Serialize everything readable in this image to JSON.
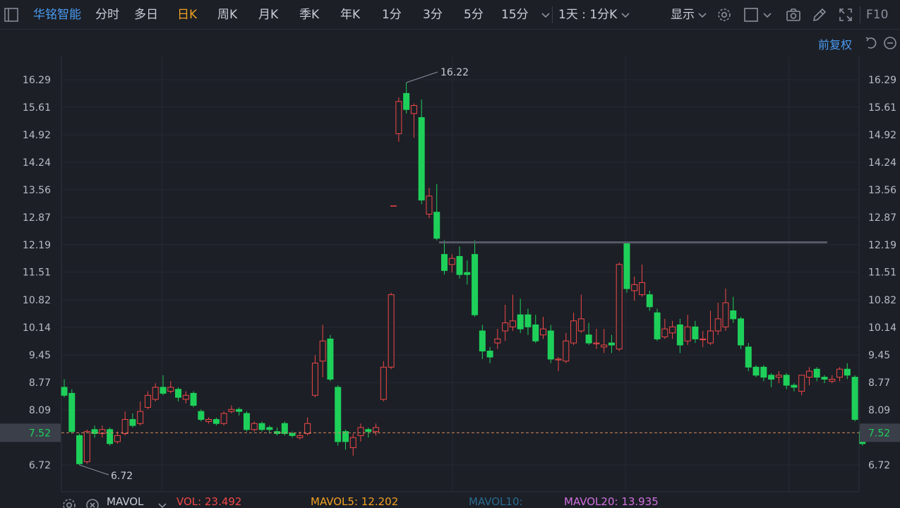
{
  "toolbar": {
    "stock_name": "华铭智能",
    "periods": [
      {
        "label": "分时",
        "active": false
      },
      {
        "label": "多日",
        "active": false
      },
      {
        "label": "日K",
        "active": true
      },
      {
        "label": "周K",
        "active": false
      },
      {
        "label": "月K",
        "active": false
      },
      {
        "label": "季K",
        "active": false
      },
      {
        "label": "年K",
        "active": false
      },
      {
        "label": "1分",
        "active": false
      },
      {
        "label": "3分",
        "active": false
      },
      {
        "label": "5分",
        "active": false
      },
      {
        "label": "15分",
        "active": false
      }
    ],
    "multi_period": "1天 : 1分K",
    "display_label": "显示",
    "f10_label": "F10"
  },
  "adjust_label": "前复权",
  "colors": {
    "up": "#f04848",
    "down": "#1ed05a",
    "accent": "#4a9bf0",
    "active_period": "#f0a020"
  },
  "chart_data": {
    "type": "candlestick",
    "y_ticks": [
      "16.29",
      "15.61",
      "14.92",
      "14.24",
      "13.56",
      "12.87",
      "12.19",
      "11.51",
      "10.82",
      "10.14",
      "9.45",
      "8.77",
      "8.09",
      "7.52",
      "6.72"
    ],
    "ylim": [
      6.25,
      16.55
    ],
    "current_price": "7.52",
    "high_label": "16.22",
    "low_label": "6.72",
    "resistance_level": 12.25,
    "candles": [
      [
        8.65,
        8.45,
        8.85,
        8.4
      ],
      [
        8.5,
        7.55,
        8.6,
        7.5
      ],
      [
        7.45,
        6.75,
        7.5,
        6.72
      ],
      [
        6.8,
        7.55,
        7.6,
        6.75
      ],
      [
        7.6,
        7.5,
        7.7,
        7.4
      ],
      [
        7.5,
        7.6,
        7.7,
        7.4
      ],
      [
        7.6,
        7.25,
        7.65,
        7.2
      ],
      [
        7.3,
        7.45,
        7.55,
        7.25
      ],
      [
        7.5,
        7.85,
        8.05,
        7.45
      ],
      [
        7.85,
        7.7,
        8.0,
        7.65
      ],
      [
        7.75,
        8.05,
        8.3,
        7.7
      ],
      [
        8.15,
        8.45,
        8.55,
        8.1
      ],
      [
        8.35,
        8.65,
        8.75,
        8.3
      ],
      [
        8.65,
        8.5,
        8.95,
        8.45
      ],
      [
        8.55,
        8.65,
        8.8,
        8.5
      ],
      [
        8.6,
        8.4,
        8.65,
        8.3
      ],
      [
        8.35,
        8.45,
        8.55,
        8.25
      ],
      [
        8.5,
        8.2,
        8.55,
        8.15
      ],
      [
        8.05,
        7.85,
        8.1,
        7.8
      ],
      [
        7.8,
        7.85,
        7.9,
        7.75
      ],
      [
        7.85,
        7.75,
        7.9,
        7.7
      ],
      [
        7.75,
        8.0,
        8.05,
        7.7
      ],
      [
        8.05,
        8.1,
        8.2,
        8.0
      ],
      [
        8.1,
        8.05,
        8.15,
        7.95
      ],
      [
        8.0,
        7.6,
        8.05,
        7.55
      ],
      [
        7.6,
        7.75,
        7.8,
        7.55
      ],
      [
        7.75,
        7.6,
        7.8,
        7.55
      ],
      [
        7.65,
        7.6,
        7.7,
        7.5
      ],
      [
        7.55,
        7.5,
        7.65,
        7.45
      ],
      [
        7.75,
        7.5,
        7.8,
        7.45
      ],
      [
        7.5,
        7.45,
        7.55,
        7.4
      ],
      [
        7.4,
        7.45,
        7.55,
        7.35
      ],
      [
        7.5,
        7.75,
        7.9,
        7.45
      ],
      [
        8.45,
        9.25,
        9.45,
        8.4
      ],
      [
        9.3,
        9.8,
        10.2,
        8.9
      ],
      [
        9.85,
        8.85,
        9.95,
        8.8
      ],
      [
        8.65,
        7.3,
        8.7,
        7.2
      ],
      [
        7.55,
        7.3,
        7.6,
        7.1
      ],
      [
        7.15,
        7.4,
        7.5,
        6.95
      ],
      [
        7.45,
        7.65,
        7.75,
        7.3
      ],
      [
        7.6,
        7.55,
        7.65,
        7.4
      ],
      [
        7.55,
        7.65,
        7.75,
        7.45
      ],
      [
        8.35,
        9.15,
        9.3,
        8.3
      ],
      [
        9.15,
        10.95,
        11.0,
        9.1
      ],
      [
        14.95,
        15.75,
        15.85,
        14.75
      ],
      [
        15.95,
        15.55,
        16.22,
        15.45
      ],
      [
        15.45,
        15.65,
        15.7,
        14.85
      ],
      [
        15.35,
        13.3,
        15.8,
        13.2
      ],
      [
        12.95,
        13.4,
        13.6,
        12.85
      ],
      [
        13.0,
        12.35,
        13.7,
        12.3
      ],
      [
        11.95,
        11.55,
        12.3,
        11.45
      ],
      [
        11.7,
        11.85,
        11.95,
        11.5
      ],
      [
        11.9,
        11.45,
        12.15,
        11.35
      ],
      [
        11.5,
        11.45,
        11.8,
        11.2
      ],
      [
        11.95,
        10.45,
        12.3,
        10.4
      ],
      [
        10.05,
        9.55,
        10.2,
        9.35
      ],
      [
        9.55,
        9.4,
        9.65,
        9.25
      ],
      [
        9.75,
        9.85,
        10.1,
        9.6
      ],
      [
        10.05,
        10.25,
        10.7,
        9.8
      ],
      [
        10.15,
        10.3,
        10.95,
        10.05
      ],
      [
        10.45,
        10.1,
        10.85,
        10.0
      ],
      [
        10.45,
        10.15,
        10.6,
        9.95
      ],
      [
        10.2,
        9.8,
        10.45,
        9.75
      ],
      [
        9.95,
        10.1,
        10.4,
        9.85
      ],
      [
        10.05,
        9.35,
        10.2,
        9.25
      ],
      [
        9.35,
        9.35,
        9.4,
        9.05
      ],
      [
        9.3,
        9.8,
        10.0,
        9.25
      ],
      [
        9.75,
        10.3,
        10.5,
        9.7
      ],
      [
        10.05,
        10.35,
        10.95,
        10.0
      ],
      [
        9.95,
        9.75,
        10.25,
        9.7
      ],
      [
        9.75,
        9.75,
        10.1,
        9.6
      ],
      [
        9.65,
        9.7,
        10.1,
        9.5
      ],
      [
        9.75,
        9.7,
        9.95,
        9.5
      ],
      [
        9.6,
        11.7,
        11.75,
        9.55
      ],
      [
        12.25,
        11.1,
        12.25,
        11.0
      ],
      [
        11.05,
        11.2,
        11.4,
        10.8
      ],
      [
        10.95,
        11.25,
        11.7,
        10.9
      ],
      [
        10.95,
        10.65,
        11.05,
        10.55
      ],
      [
        10.5,
        9.85,
        10.6,
        9.8
      ],
      [
        9.9,
        10.1,
        10.35,
        9.85
      ],
      [
        10.0,
        10.15,
        10.3,
        9.85
      ],
      [
        10.2,
        9.7,
        10.35,
        9.5
      ],
      [
        9.8,
        10.15,
        10.45,
        9.7
      ],
      [
        10.15,
        9.85,
        10.3,
        9.75
      ],
      [
        9.85,
        9.85,
        10.05,
        9.65
      ],
      [
        9.75,
        10.05,
        10.55,
        9.7
      ],
      [
        10.05,
        10.35,
        10.75,
        9.95
      ],
      [
        10.15,
        10.75,
        11.1,
        10.05
      ],
      [
        10.55,
        10.35,
        10.9,
        10.25
      ],
      [
        10.35,
        9.7,
        10.4,
        9.6
      ],
      [
        9.65,
        9.15,
        9.75,
        9.05
      ],
      [
        9.15,
        8.95,
        9.2,
        8.9
      ],
      [
        9.15,
        8.9,
        9.2,
        8.8
      ],
      [
        8.95,
        8.85,
        9.0,
        8.65
      ],
      [
        8.9,
        8.95,
        9.05,
        8.75
      ],
      [
        8.95,
        8.7,
        9.0,
        8.6
      ],
      [
        8.7,
        8.65,
        8.75,
        8.55
      ],
      [
        8.55,
        8.95,
        8.95,
        8.45
      ],
      [
        8.9,
        9.05,
        9.15,
        8.7
      ],
      [
        9.1,
        8.9,
        9.15,
        8.8
      ],
      [
        8.9,
        8.85,
        8.95,
        8.75
      ],
      [
        8.8,
        8.85,
        8.95,
        8.75
      ],
      [
        8.9,
        9.1,
        9.15,
        8.8
      ],
      [
        9.1,
        8.95,
        9.25,
        8.85
      ],
      [
        8.9,
        7.85,
        8.95,
        7.8
      ],
      [
        7.55,
        7.25,
        7.7,
        7.2
      ]
    ],
    "bottom_indicators": [
      {
        "label": "MAVOL",
        "color": "#c8ccd4"
      },
      {
        "label": "VOL: 23.492",
        "color": "#f04848"
      },
      {
        "label": "MAVOL5: 12.202",
        "color": "#f0a020"
      },
      {
        "label": "MAVOL10:",
        "color": "#2a6a90"
      },
      {
        "label": "MAVOL20: 13.935",
        "color": "#d070e0"
      }
    ]
  }
}
